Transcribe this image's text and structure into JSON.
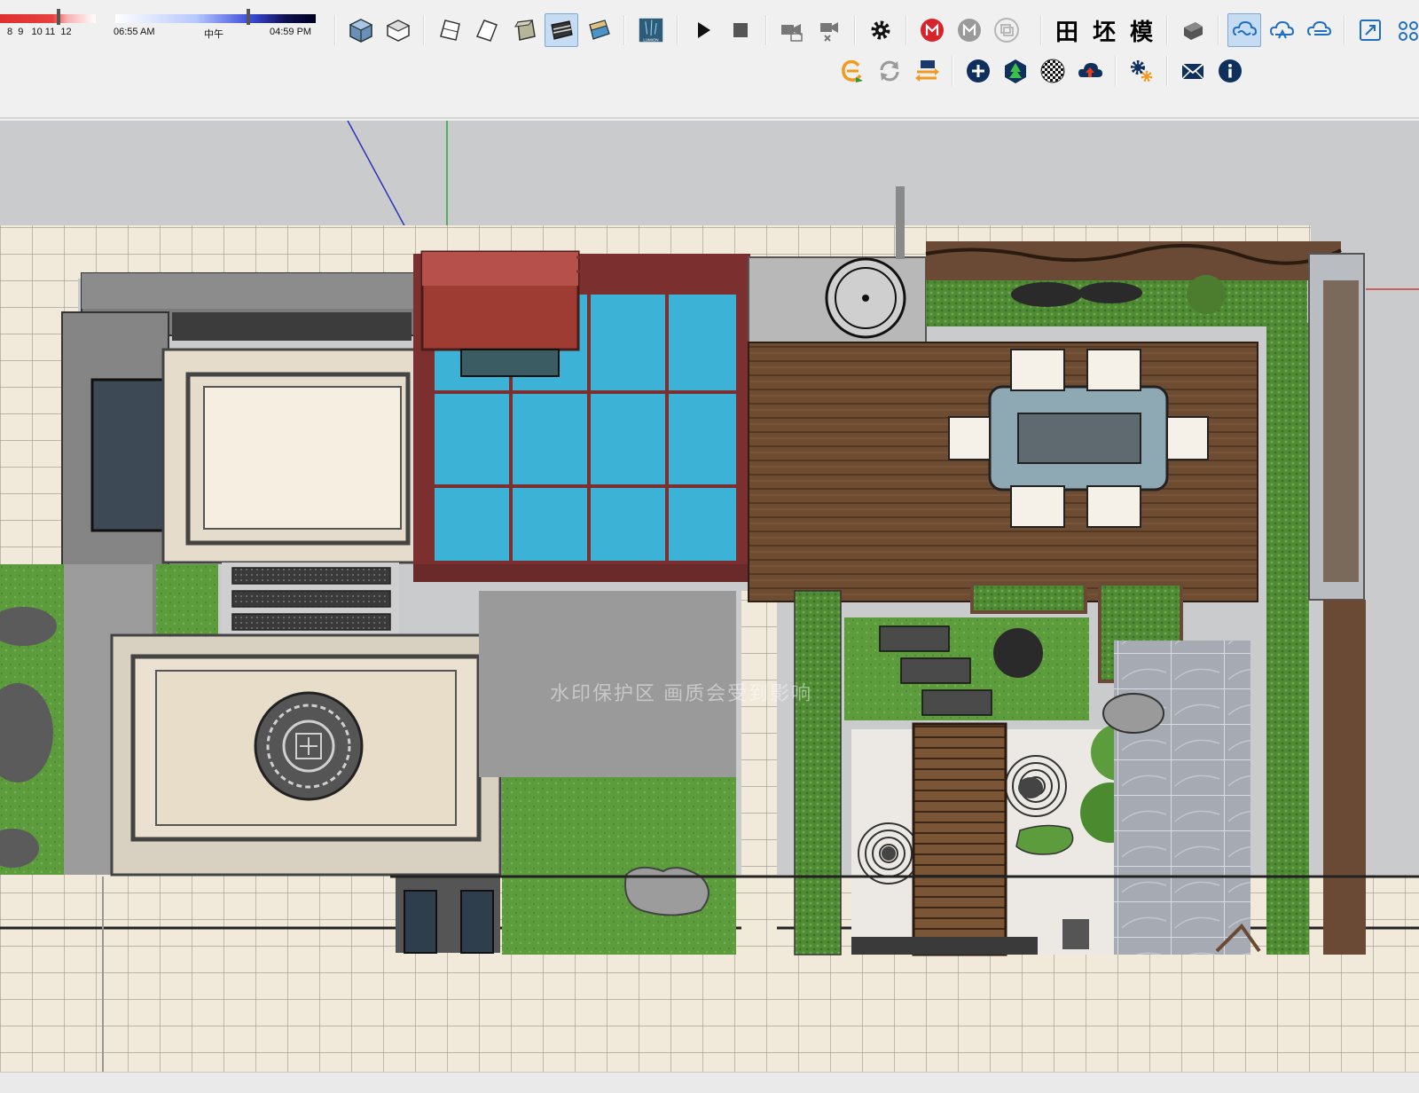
{
  "toolbar": {
    "shadow": {
      "month_ticks": "8  9   10 11  12",
      "time_start": "06:55 AM",
      "time_mid": "中午",
      "time_end": "04:59 PM"
    },
    "row1_icons": [
      "iso-view-icon",
      "top-view-icon",
      "front-view-icon",
      "right-view-icon",
      "back-view-icon",
      "left-view-icon",
      "monochrome-style-icon",
      "shaded-textured-icon",
      "lumion-icon",
      "play-icon",
      "stop-icon",
      "camera-icon",
      "camera-remove-icon",
      "settings-gear-icon",
      "tool-red-m-icon",
      "tool-gray-m-icon",
      "tool-gray-copy-icon",
      "plugin-tian-icon",
      "plugin-huan-icon",
      "plugin-mo-icon",
      "warehouse-icon",
      "cloud-link-icon",
      "cloud-sync-icon",
      "cloud-upload-icon",
      "expand-icon",
      "network-icon"
    ],
    "plugin_labels": {
      "tian": "田",
      "huan": "坯",
      "mo": "模"
    },
    "lumion_label": "LUMION",
    "row2_icons": [
      "enscape-icon",
      "refresh-icon",
      "transfer-icon",
      "add-icon",
      "tree-icon",
      "checker-icon",
      "cloud-upload-dark-icon",
      "gears-icon",
      "mail-icon",
      "info-icon"
    ]
  },
  "viewport": {
    "watermark": "水印保护区  画质会受到影响",
    "colors": {
      "sky": "#c9cbcd",
      "paving": "#f1eadb",
      "grass": "#5d9c3c",
      "deck": "#6e4c32",
      "glass": "#3cb2d6",
      "frame": "#7b2f2f",
      "stone": "#8c8c8c"
    }
  }
}
